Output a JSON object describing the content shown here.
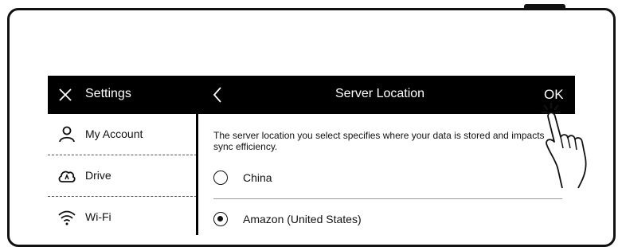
{
  "header": {
    "settings_title": "Settings",
    "page_title": "Server Location",
    "ok_label": "OK"
  },
  "sidebar": {
    "items": [
      {
        "label": "My Account",
        "icon": "person-icon"
      },
      {
        "label": "Drive",
        "icon": "cloud-drive-icon"
      },
      {
        "label": "Wi-Fi",
        "icon": "wifi-icon"
      }
    ]
  },
  "content": {
    "description": "The server location you select specifies where your data is stored and impacts sync efficiency.",
    "options": [
      {
        "label": "China",
        "selected": false
      },
      {
        "label": "Amazon (United States)",
        "selected": true
      }
    ]
  },
  "icons": {
    "close": "close-icon",
    "back": "back-icon",
    "pointer": "hand-pointer-icon"
  }
}
